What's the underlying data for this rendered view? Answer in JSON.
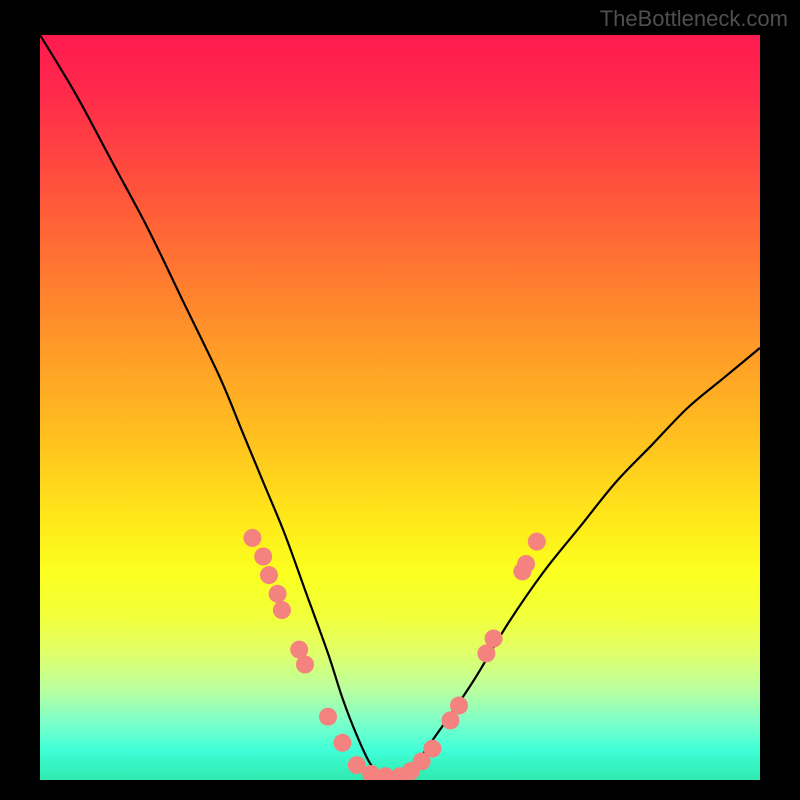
{
  "watermark": "TheBottleneck.com",
  "chart_data": {
    "type": "line",
    "title": "",
    "xlabel": "",
    "ylabel": "",
    "xlim": [
      0,
      100
    ],
    "ylim": [
      0,
      100
    ],
    "curve": {
      "name": "bottleneck-curve",
      "x": [
        0,
        5,
        10,
        15,
        20,
        25,
        28,
        31,
        34,
        37,
        40,
        42,
        44,
        46,
        48,
        50,
        52,
        55,
        60,
        65,
        70,
        75,
        80,
        85,
        90,
        95,
        100
      ],
      "y": [
        100,
        92,
        83,
        74,
        64,
        54,
        47,
        40,
        33,
        25,
        17,
        11,
        6,
        2,
        0.5,
        0.5,
        2,
        6,
        13,
        21,
        28,
        34,
        40,
        45,
        50,
        54,
        58
      ]
    },
    "dots": {
      "name": "data-points",
      "color": "#f4827e",
      "radius_px": 9,
      "points": [
        {
          "x": 29.5,
          "y": 32.5
        },
        {
          "x": 31.0,
          "y": 30.0
        },
        {
          "x": 31.8,
          "y": 27.5
        },
        {
          "x": 33.0,
          "y": 25.0
        },
        {
          "x": 33.6,
          "y": 22.8
        },
        {
          "x": 36.0,
          "y": 17.5
        },
        {
          "x": 36.8,
          "y": 15.5
        },
        {
          "x": 40.0,
          "y": 8.5
        },
        {
          "x": 42.0,
          "y": 5.0
        },
        {
          "x": 44.0,
          "y": 2.0
        },
        {
          "x": 46.0,
          "y": 0.8
        },
        {
          "x": 48.0,
          "y": 0.5
        },
        {
          "x": 50.0,
          "y": 0.5
        },
        {
          "x": 51.5,
          "y": 1.2
        },
        {
          "x": 53.0,
          "y": 2.5
        },
        {
          "x": 54.5,
          "y": 4.2
        },
        {
          "x": 57.0,
          "y": 8.0
        },
        {
          "x": 58.2,
          "y": 10.0
        },
        {
          "x": 62.0,
          "y": 17.0
        },
        {
          "x": 63.0,
          "y": 19.0
        },
        {
          "x": 67.0,
          "y": 28.0
        },
        {
          "x": 67.5,
          "y": 29.0
        },
        {
          "x": 69.0,
          "y": 32.0
        }
      ]
    },
    "gradient_bands": [
      {
        "position_pct": 0,
        "color": "#ff1a50"
      },
      {
        "position_pct": 50,
        "color": "#ffc01f"
      },
      {
        "position_pct": 75,
        "color": "#f2ff3a"
      },
      {
        "position_pct": 100,
        "color": "#2fe9af"
      }
    ]
  }
}
